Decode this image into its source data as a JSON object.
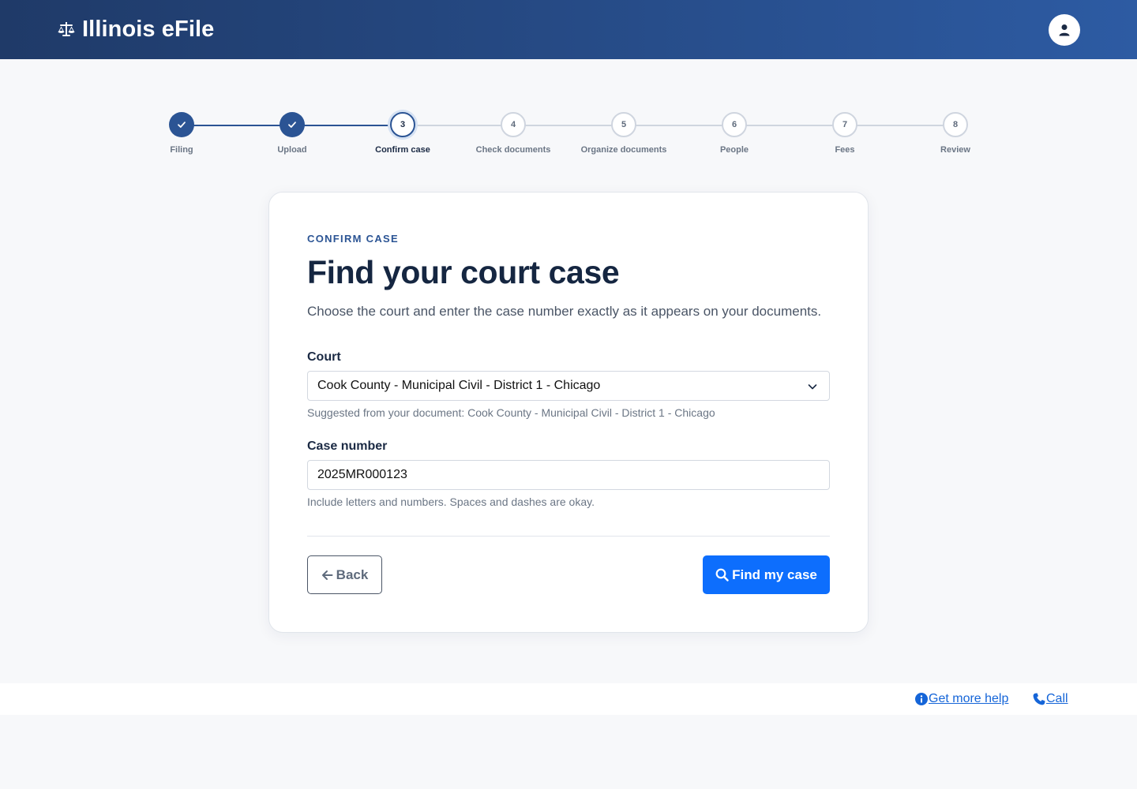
{
  "header": {
    "app_title": "Illinois eFile",
    "logo_icon": "balance-scale-icon",
    "account_icon": "user-icon"
  },
  "stepper": {
    "steps": [
      {
        "number": "1",
        "label": "Filing",
        "status": "complete"
      },
      {
        "number": "2",
        "label": "Upload",
        "status": "complete"
      },
      {
        "number": "3",
        "label": "Confirm case",
        "status": "current"
      },
      {
        "number": "4",
        "label": "Check documents",
        "status": "upcoming"
      },
      {
        "number": "5",
        "label": "Organize documents",
        "status": "upcoming"
      },
      {
        "number": "6",
        "label": "People",
        "status": "upcoming"
      },
      {
        "number": "7",
        "label": "Fees",
        "status": "upcoming"
      },
      {
        "number": "8",
        "label": "Review",
        "status": "upcoming"
      }
    ]
  },
  "card": {
    "eyebrow": "CONFIRM CASE",
    "title": "Find your court case",
    "intro": "Choose the court and enter the case number exactly as it appears on your documents.",
    "court": {
      "label": "Court",
      "selected": "Cook County - Municipal Civil - District 1 - Chicago",
      "hint": "Suggested from your document: Cook County - Municipal Civil - District 1 - Chicago"
    },
    "case_number": {
      "label": "Case number",
      "value": "2025MR000123",
      "hint": "Include letters and numbers. Spaces and dashes are okay."
    },
    "back_label": "Back",
    "find_label": "Find my case"
  },
  "footer": {
    "help_label": "Get more help",
    "call_label": "Call"
  },
  "colors": {
    "header_start": "#1f3a68",
    "header_end": "#2d5ba3",
    "step_active": "#2b5494",
    "primary_button": "#0d6efd",
    "link": "#1565d8"
  }
}
